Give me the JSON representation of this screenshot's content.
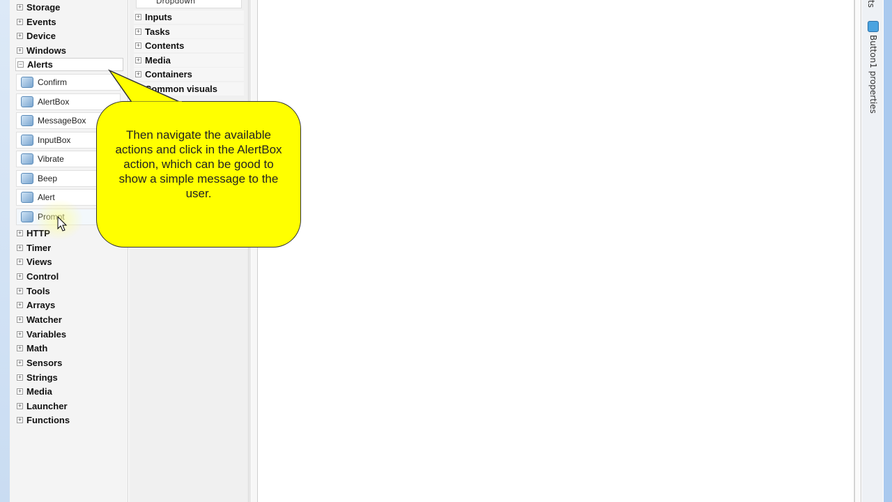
{
  "left_panel": {
    "categories_top": [
      "Storage",
      "Events",
      "Device",
      "Windows"
    ],
    "open_category": "Alerts",
    "actions": [
      "Confirm",
      "AlertBox",
      "MessageBox",
      "InputBox",
      "Vibrate",
      "Beep",
      "Alert",
      "Prompt"
    ],
    "categories_bottom": [
      "HTTP",
      "Timer",
      "Views",
      "Control",
      "Tools",
      "Arrays",
      "Watcher",
      "Variables",
      "Math",
      "Sensors",
      "Strings",
      "Media",
      "Launcher",
      "Functions"
    ]
  },
  "mid_panel": {
    "top_item": "Dropdown",
    "categories": [
      "Inputs",
      "Tasks",
      "Contents",
      "Media",
      "Containers",
      "Common visuals"
    ]
  },
  "callout": {
    "text": "Then navigate the available actions and click in the AlertBox action, which can be good to show a simple message to the user.",
    "color": "#ffff00"
  },
  "right_side": {
    "top_tab": "ts",
    "tab": "Button1 properties"
  }
}
